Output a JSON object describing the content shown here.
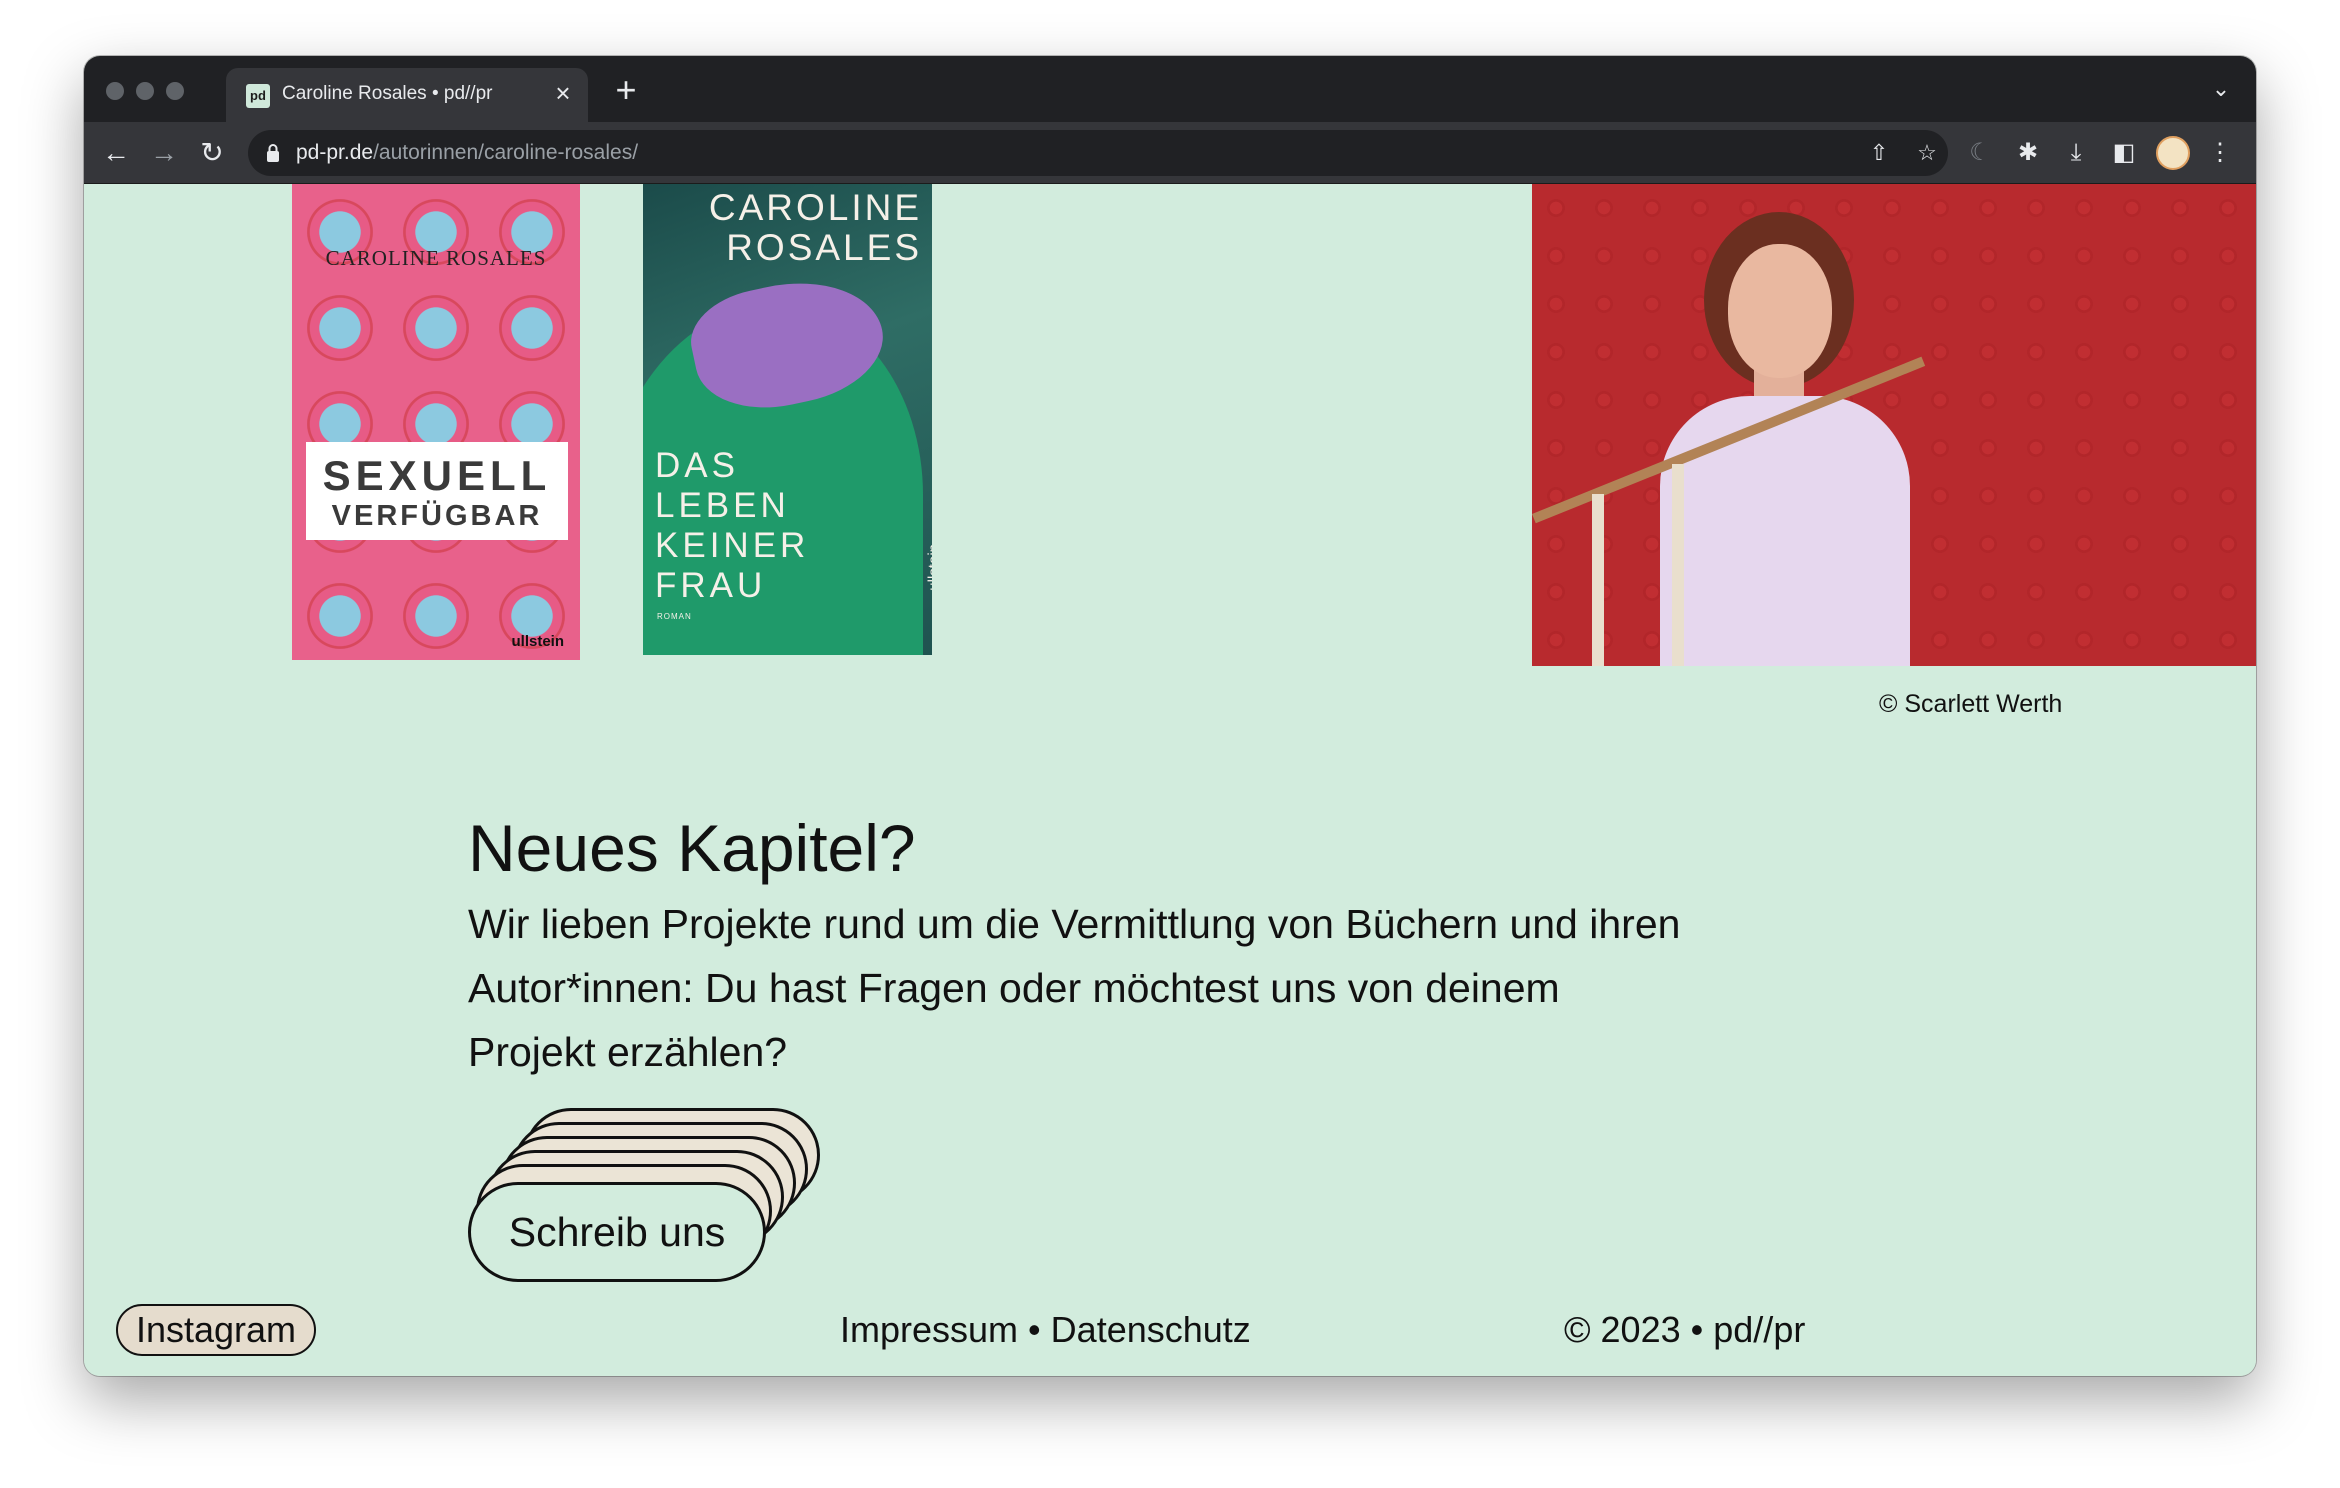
{
  "browser": {
    "tab_title": "Caroline Rosales • pd//pr",
    "favicon_text": "pd",
    "url_host": "pd-pr.de",
    "url_path": "/autorinnen/caroline-rosales/"
  },
  "books": [
    {
      "author": "CAROLINE ROSALES",
      "title_line1": "SEXUELL",
      "title_line2": "VERFÜGBAR",
      "publisher": "ullstein"
    },
    {
      "author_line1": "CAROLINE",
      "author_line2": "ROSALES",
      "title_lines": [
        "DAS",
        "LEBEN",
        "KEINER",
        "FRAU"
      ],
      "genre": "ROMAN",
      "publisher": "ullstein"
    }
  ],
  "photo": {
    "caption": "© Scarlett Werth"
  },
  "contact": {
    "heading": "Neues Kapitel?",
    "body": "Wir lieben Projekte rund um die Vermittlung von Büchern und ihren Autor*innen: Du hast Fragen oder möchtest uns von deinem Projekt erzählen?",
    "cta_label": "Schreib uns"
  },
  "footer": {
    "instagram": "Instagram",
    "impressum": "Impressum",
    "separator": "•",
    "datenschutz": "Datenschutz",
    "copyright": "© 2023",
    "brand": "pd//pr"
  },
  "colors": {
    "page_bg": "#d2ecdd",
    "text": "#111111",
    "browser_chrome": "#202124",
    "photo_bg": "#b82a2e"
  },
  "icons": [
    "back-arrow-icon",
    "forward-arrow-icon",
    "reload-icon",
    "lock-icon",
    "share-icon",
    "star-icon",
    "extension-icon",
    "puzzle-icon",
    "download-icon",
    "sidepanel-icon",
    "kebab-menu-icon",
    "close-icon",
    "plus-icon",
    "chevron-down-icon"
  ]
}
